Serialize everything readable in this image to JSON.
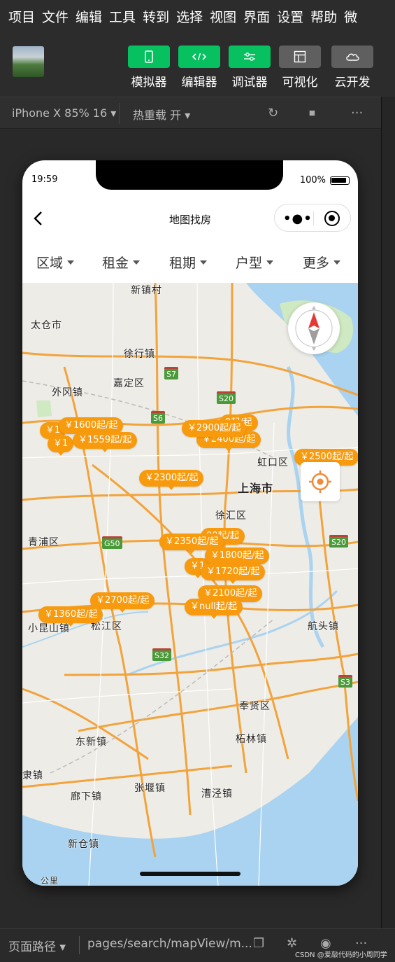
{
  "menu": [
    "项目",
    "文件",
    "编辑",
    "工具",
    "转到",
    "选择",
    "视图",
    "界面",
    "设置",
    "帮助",
    "微"
  ],
  "toolbar": {
    "simulator": "模拟器",
    "editor": "编辑器",
    "debugger": "调试器",
    "visualize": "可视化",
    "cloud": "云开发"
  },
  "device": {
    "label": "iPhone X 85% 16",
    "hotreload": "热重载 开"
  },
  "status": {
    "time": "19:59",
    "battery": "100%"
  },
  "nav": {
    "title": "地图找房"
  },
  "filters": [
    "区域",
    "租金",
    "租期",
    "户型",
    "更多"
  ],
  "places": {
    "xinzhen": "新镇村",
    "taicang": "太仓市",
    "xuhang": "徐行镇",
    "waigang": "外冈镇",
    "jiading": "嘉定区",
    "hongkou": "虹口区",
    "shanghai": "上海市",
    "xuhui": "徐汇区",
    "qingpu": "青浦区",
    "xiaokunshan": "小昆山镇",
    "songjiang": "松江区",
    "hangtou": "航头镇",
    "fengxian": "奉贤区",
    "donxin": "东新镇",
    "zhelin": "柘林镇",
    "zhangyan": "张堰镇",
    "langxia": "廊下镇",
    "caojing": "漕泾镇",
    "xincang": "新仓镇",
    "liding": "隶镇",
    "gongli": "公里"
  },
  "shields": {
    "s7": "S7",
    "s20a": "S20",
    "s6": "S6",
    "g50": "G50",
    "s20b": "S20",
    "s32": "S32",
    "s3": "S3"
  },
  "markers": [
    "￥1600起/起",
    "￥1559起/起",
    "￥1",
    "￥1",
    "￥2900起/起",
    "0起/起",
    "￥2400起/起",
    "￥2500起/起",
    "￥2300起/起",
    "￥2350起/起",
    "00起/起",
    "￥1800起/起",
    "￥1",
    "￥1720起/起",
    "￥2100起/起",
    "￥null起/起",
    "￥2700起/起",
    "￥1360起/起"
  ],
  "bottom": {
    "label": "页面路径",
    "path": "pages/search/mapView/m..."
  },
  "watermark": "CSDN @爱敲代码的小周同学"
}
